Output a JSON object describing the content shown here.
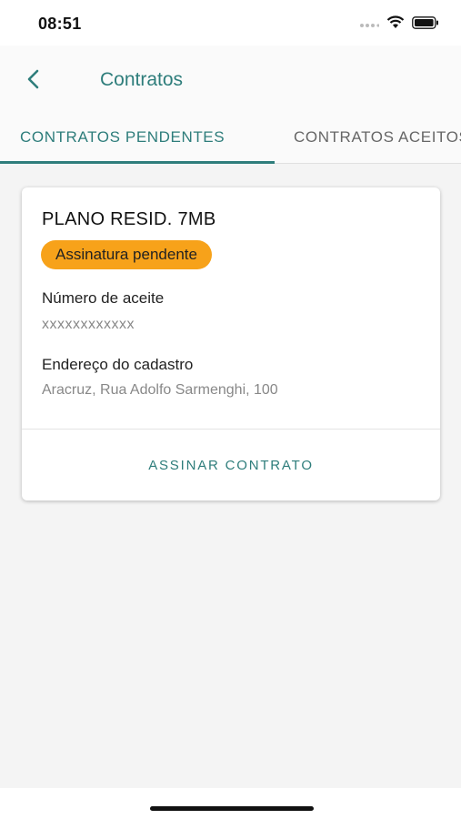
{
  "status_bar": {
    "time": "08:51",
    "icons": [
      "signal-dots-icon",
      "wifi-icon",
      "battery-icon"
    ]
  },
  "header": {
    "back_icon": "chevron-left-icon",
    "title": "Contratos"
  },
  "tabs": [
    {
      "label": "CONTRATOS PENDENTES",
      "active": true
    },
    {
      "label": "CONTRATOS ACEITOS",
      "active": false
    }
  ],
  "contract_card": {
    "plan_name": "PLANO RESID. 7MB",
    "status_badge": "Assinatura pendente",
    "acceptance_number_label": "Número de aceite",
    "acceptance_number_value": "xxxxxxxxxxxx",
    "address_label": "Endereço do cadastro",
    "address_value": "Aracruz, Rua Adolfo Sarmenghi, 100",
    "action_label": "ASSINAR CONTRATO"
  },
  "colors": {
    "accent": "#2e7d7b",
    "badge": "#f7a21a",
    "background": "#f4f4f4"
  }
}
